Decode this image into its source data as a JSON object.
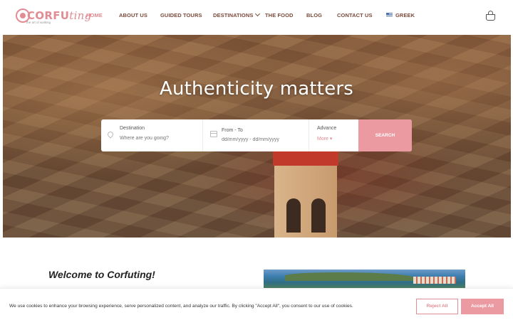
{
  "header": {
    "logo": {
      "word": "CORFU",
      "script": "ting",
      "tagline": "the art of walking"
    },
    "nav": [
      {
        "label": "HOME",
        "active": true
      },
      {
        "label": "ABOUT US"
      },
      {
        "label": "GUIDED TOURS"
      },
      {
        "label": "DESTINATIONS",
        "has_dropdown": true
      },
      {
        "label": "THE FOOD"
      },
      {
        "label": "BLOG"
      },
      {
        "label": "CONTACT US"
      },
      {
        "label": "GREEK",
        "icon": "greek-flag-icon"
      }
    ],
    "cart_icon": "basket-icon"
  },
  "hero": {
    "title": "Authenticity matters",
    "search": {
      "destination": {
        "label": "Destination",
        "placeholder": "Where are you going?",
        "icon": "map-pin-icon"
      },
      "dates": {
        "label": "From - To",
        "placeholder": "dd/mm/yyyy - dd/mm/yyyy",
        "icon": "calendar-icon"
      },
      "advance": {
        "label": "Advance",
        "link": "More ▾"
      },
      "button": "SEARCH"
    }
  },
  "welcome": {
    "title": "Welcome to Corfuting!"
  },
  "cookie": {
    "text": "We use cookies to enhance your browsing experience, serve personalized content, and analyze our traffic. By clicking \"Accept All\", you consent to our use of cookies.",
    "reject": "Reject All",
    "accept": "Accept All"
  },
  "colors": {
    "accent": "#ec9aa2",
    "nav_text": "#7c4a3a",
    "nav_active": "#e28c93"
  }
}
